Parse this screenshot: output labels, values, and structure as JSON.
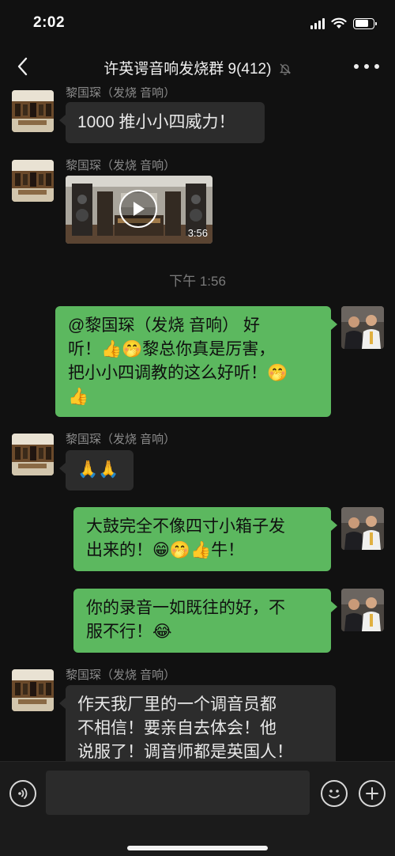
{
  "status_bar": {
    "time": "2:02"
  },
  "header": {
    "title": "许英谔音响发烧群 9(412)"
  },
  "messages": [
    {
      "sender": "黎国琛（发烧 音响）",
      "text": "1000 推小小四威力！"
    },
    {
      "sender": "黎国琛（发烧 音响）",
      "video_duration": "3:56"
    },
    {
      "timestamp": "下午 1:56"
    },
    {
      "lines": [
        "@黎国琛（发烧 音响） 好",
        "听！👍🤭黎总你真是厉害，",
        "把小小四调教的这么好听！🤭",
        "👍"
      ]
    },
    {
      "sender": "黎国琛（发烧 音响）",
      "text": "🙏🙏"
    },
    {
      "lines": [
        "大鼓完全不像四寸小箱子发",
        "出来的！😁🤭👍牛！"
      ]
    },
    {
      "lines": [
        "你的录音一如既往的好，不",
        "服不行！😂"
      ]
    },
    {
      "sender": "黎国琛（发烧 音响）",
      "lines": [
        "作天我厂里的一个调音员都",
        "不相信！要亲自去体会！他",
        "说服了！调音师都是英国人！"
      ]
    }
  ],
  "colors": {
    "outgoing_bubble": "#5cb85f",
    "incoming_bubble": "#2c2c2c",
    "background": "#111111"
  },
  "icons": [
    "back-icon",
    "mute-icon",
    "more-icon",
    "play-icon",
    "voice-icon",
    "emoji-icon",
    "plus-icon"
  ]
}
